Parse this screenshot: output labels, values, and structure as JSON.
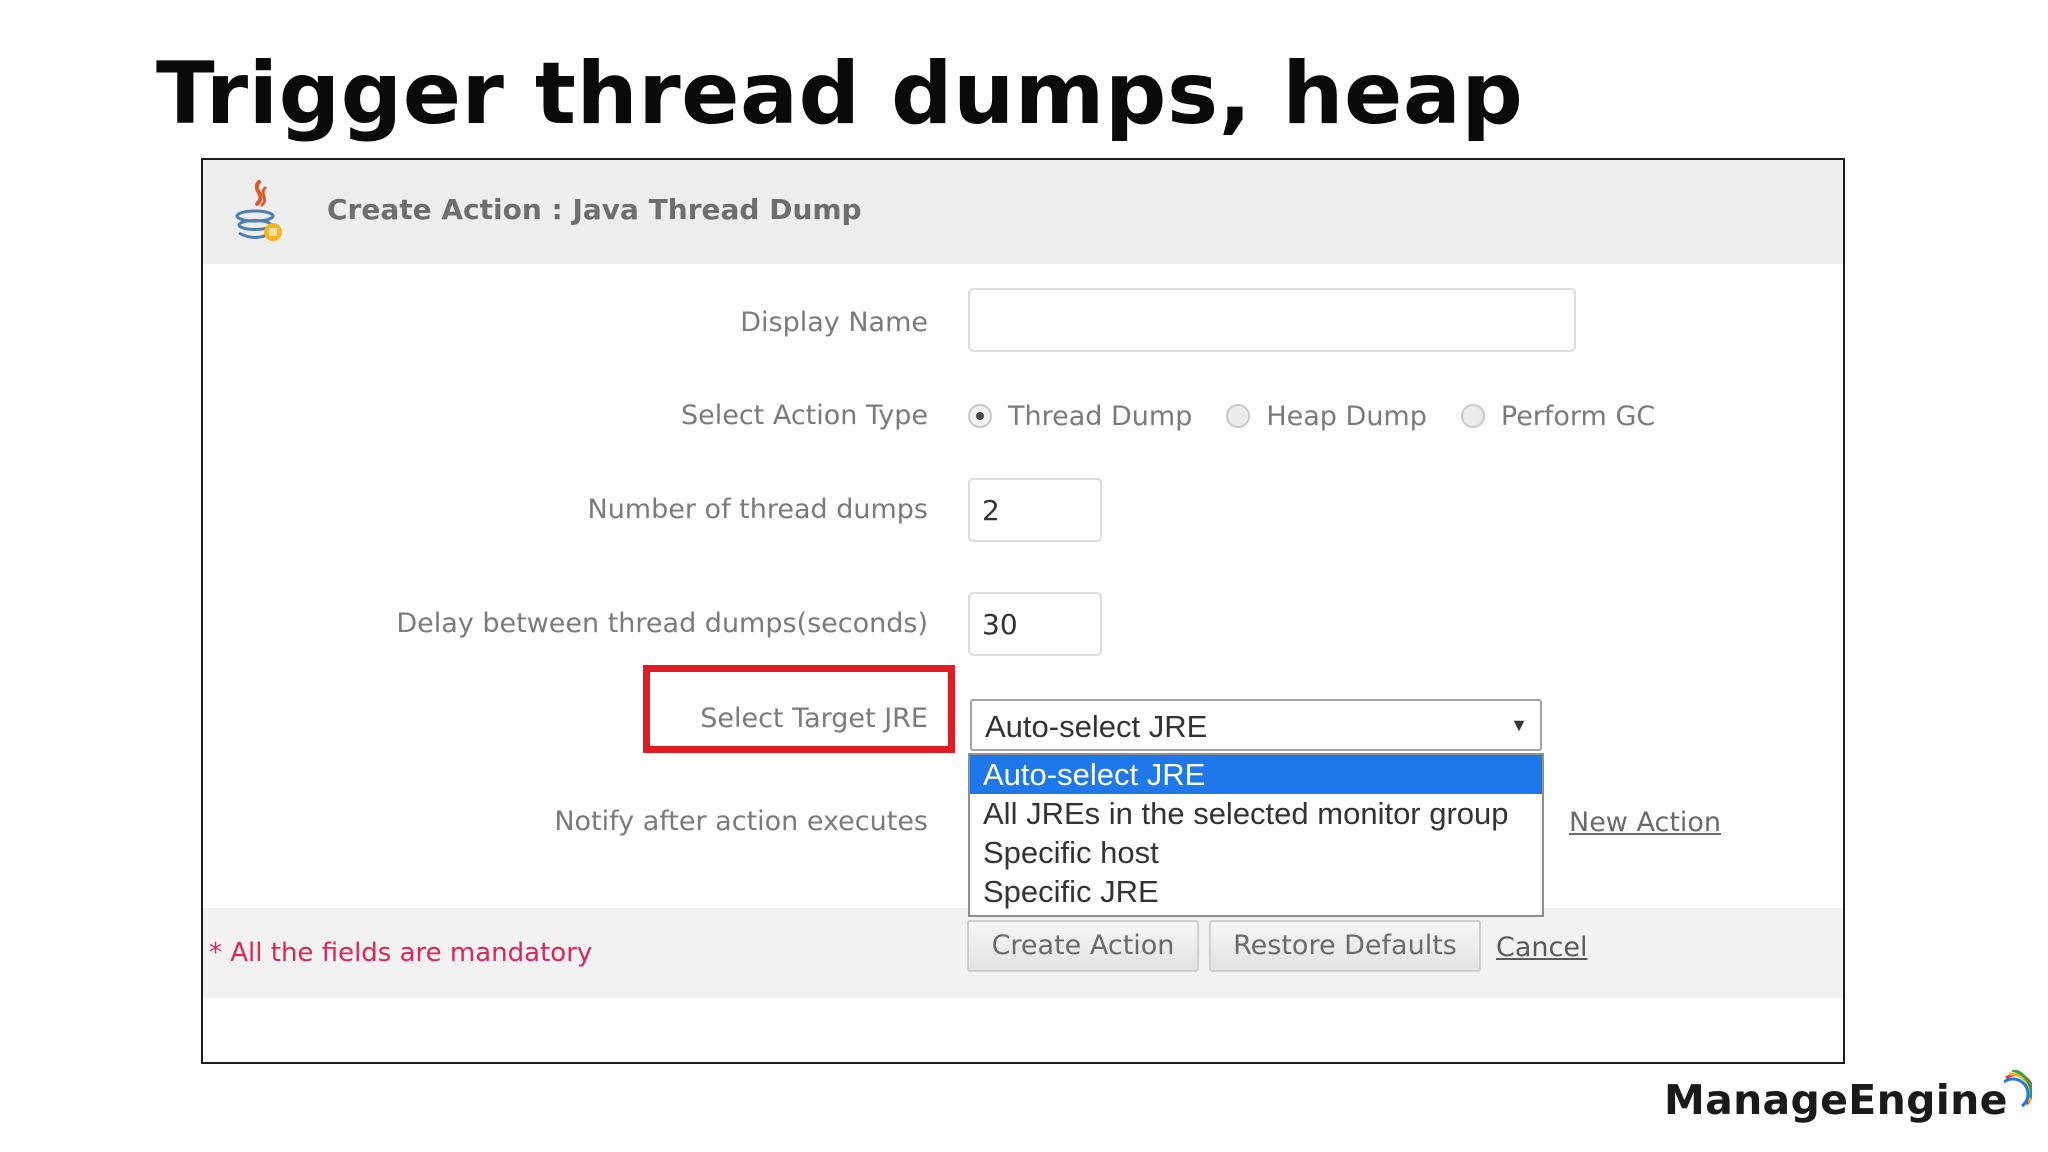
{
  "slide": {
    "title": "Trigger thread dumps, heap"
  },
  "dialog": {
    "title": "Create Action : Java Thread Dump",
    "icon": "java-icon"
  },
  "form": {
    "display_name": {
      "label": "Display Name",
      "value": ""
    },
    "action_type": {
      "label": "Select Action Type",
      "options": [
        {
          "label": "Thread Dump",
          "checked": true
        },
        {
          "label": "Heap Dump",
          "checked": false
        },
        {
          "label": "Perform GC",
          "checked": false
        }
      ]
    },
    "thread_dump_count": {
      "label": "Number of thread dumps",
      "value": "2"
    },
    "delay": {
      "label": "Delay between thread dumps(seconds)",
      "value": "30"
    },
    "target_jre": {
      "label": "Select Target JRE",
      "selected": "Auto-select JRE",
      "options": [
        "Auto-select JRE",
        "All JREs in the selected monitor group",
        "Specific host",
        "Specific JRE"
      ]
    },
    "notify": {
      "label": "Notify after action executes",
      "new_action_link": "New Action"
    }
  },
  "footer": {
    "mandatory_note": "* All the fields are mandatory",
    "create_label": "Create Action",
    "restore_label": "Restore Defaults",
    "cancel_label": "Cancel"
  },
  "brand": {
    "logo_text": "ManageEngine"
  },
  "colors": {
    "highlight_box": "#e11b22",
    "dropdown_selected": "#1e78ea",
    "mandatory_text": "#e0245a"
  }
}
